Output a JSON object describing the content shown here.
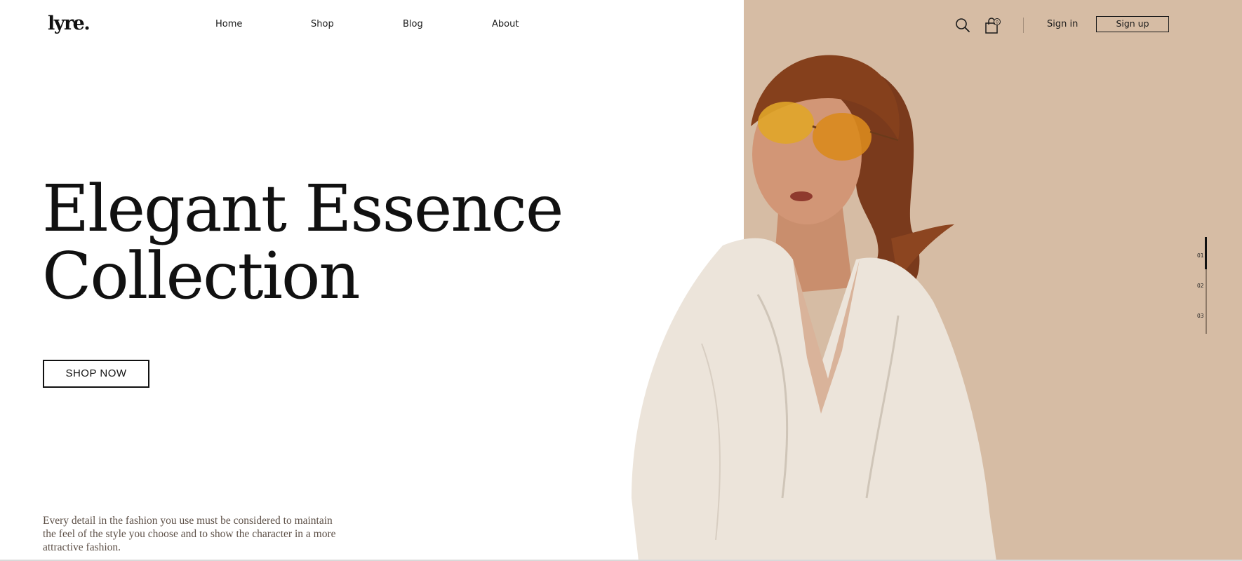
{
  "header": {
    "logo": "lyre.",
    "nav": [
      "Home",
      "Shop",
      "Blog",
      "About"
    ],
    "search_icon": "search-icon",
    "cart_icon": "shopping-bag-icon",
    "cart_count": "0",
    "signin": "Sign in",
    "signup": "Sign up"
  },
  "hero": {
    "title_line1": "Elegant Essence",
    "title_line2": "Collection",
    "cta": "SHOP NOW",
    "description": "Every detail in the fashion you use must be considered to maintain the feel of the style you choose and to show the character in a more attractive fashion."
  },
  "slider": {
    "items": [
      "01",
      "02",
      "03"
    ],
    "active_index": 0
  },
  "colors": {
    "panel": "#d6bca4",
    "text": "#111111",
    "description": "#5e5148"
  }
}
